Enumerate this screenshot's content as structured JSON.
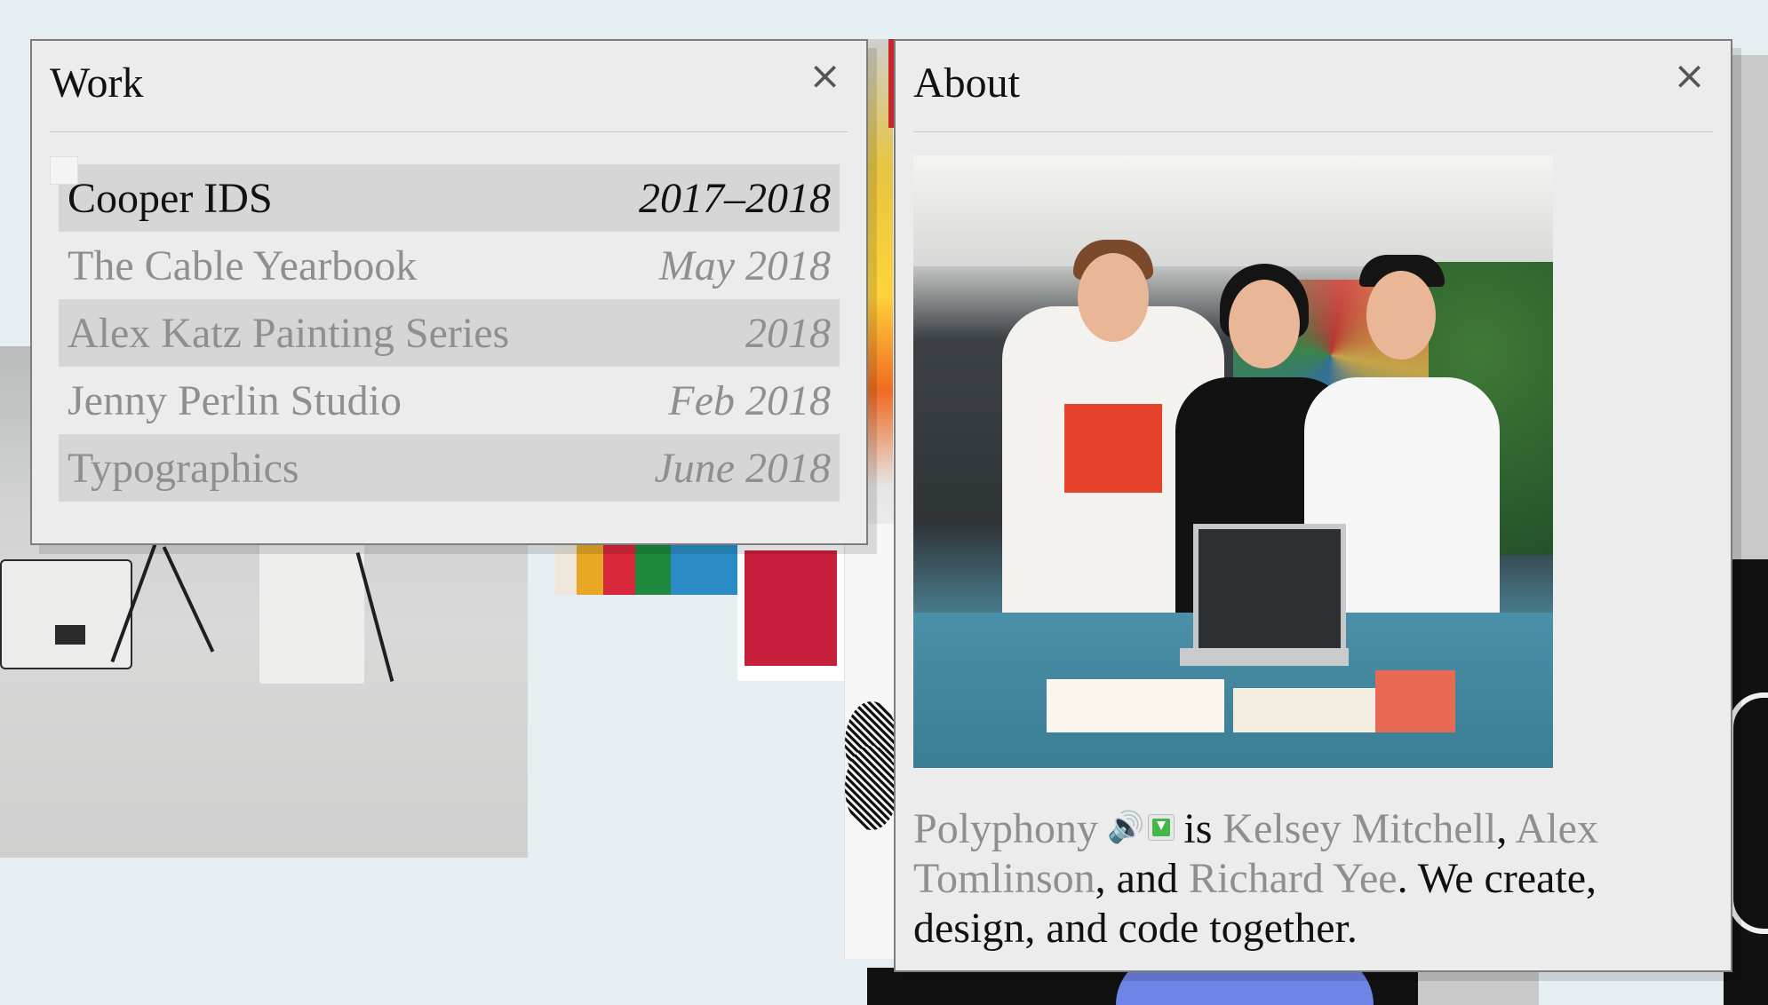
{
  "work_window": {
    "title": "Work",
    "close_icon": "×",
    "items": [
      {
        "title": "Cooper IDS",
        "date": "2017–2018",
        "active": true
      },
      {
        "title": "The Cable Yearbook",
        "date": "May 2018",
        "active": false
      },
      {
        "title": "Alex Katz Painting Series",
        "date": "2018",
        "active": false
      },
      {
        "title": "Jenny Perlin Studio",
        "date": "Feb 2018",
        "active": false
      },
      {
        "title": "Typographics",
        "date": "June 2018",
        "active": false
      }
    ]
  },
  "about_window": {
    "title": "About",
    "close_icon": "×",
    "photo_icon": "team-photo",
    "speaker_icon": "🔊",
    "download_icon": "download-icon",
    "text": {
      "name": "Polyphony",
      "is": "is",
      "person1": "Kelsey Mitchell",
      "comma1": ",",
      "person2": "Alex Tomlinson",
      "and": ", and",
      "person3": "Richard Yee",
      "rest": ". We create, design, and code together."
    }
  },
  "colors": {
    "window_bg": "#ececec",
    "row_stripe": "#d6d6d6",
    "link": "#8f8f8f",
    "text": "#111111",
    "page_bg": "#e6eef2"
  }
}
